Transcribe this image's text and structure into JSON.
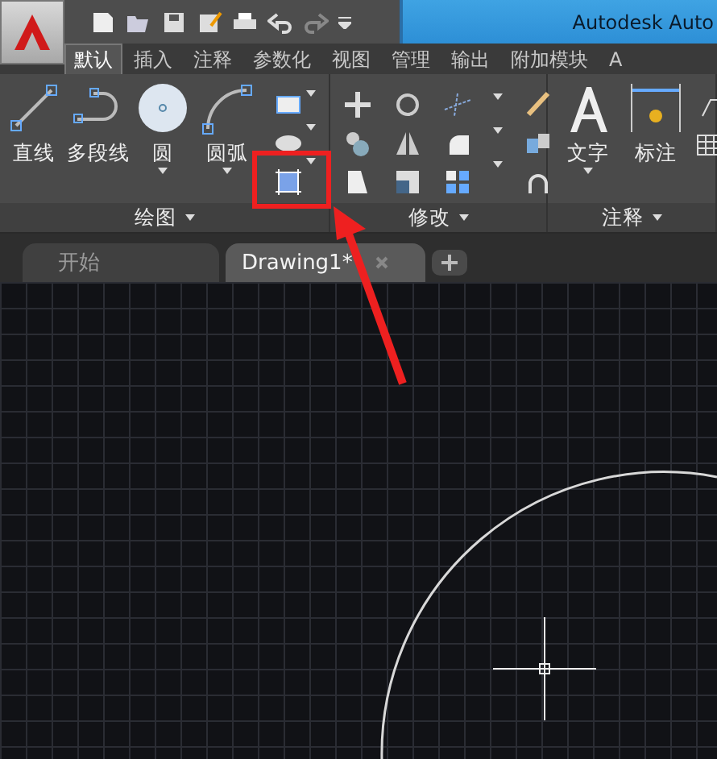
{
  "title_bar": {
    "title": "Autodesk Auto"
  },
  "ribbon_tabs": [
    {
      "label": "默认",
      "selected": true
    },
    {
      "label": "插入",
      "selected": false
    },
    {
      "label": "注释",
      "selected": false
    },
    {
      "label": "参数化",
      "selected": false
    },
    {
      "label": "视图",
      "selected": false
    },
    {
      "label": "管理",
      "selected": false
    },
    {
      "label": "输出",
      "selected": false
    },
    {
      "label": "附加模块",
      "selected": false
    },
    {
      "label": "A",
      "selected": false
    }
  ],
  "panels": [
    {
      "title": "绘图",
      "tools": [
        {
          "label": "直线",
          "dropdown": false
        },
        {
          "label": "多段线",
          "dropdown": false
        },
        {
          "label": "圆",
          "dropdown": true
        },
        {
          "label": "圆弧",
          "dropdown": true
        }
      ]
    },
    {
      "title": "修改"
    },
    {
      "title": "注释",
      "tools": [
        {
          "label": "文字",
          "dropdown": true
        },
        {
          "label": "标注",
          "dropdown": false
        }
      ]
    }
  ],
  "doc_tabs": [
    {
      "label": "开始",
      "selected": false
    },
    {
      "label": "Drawing1*",
      "selected": true
    }
  ]
}
